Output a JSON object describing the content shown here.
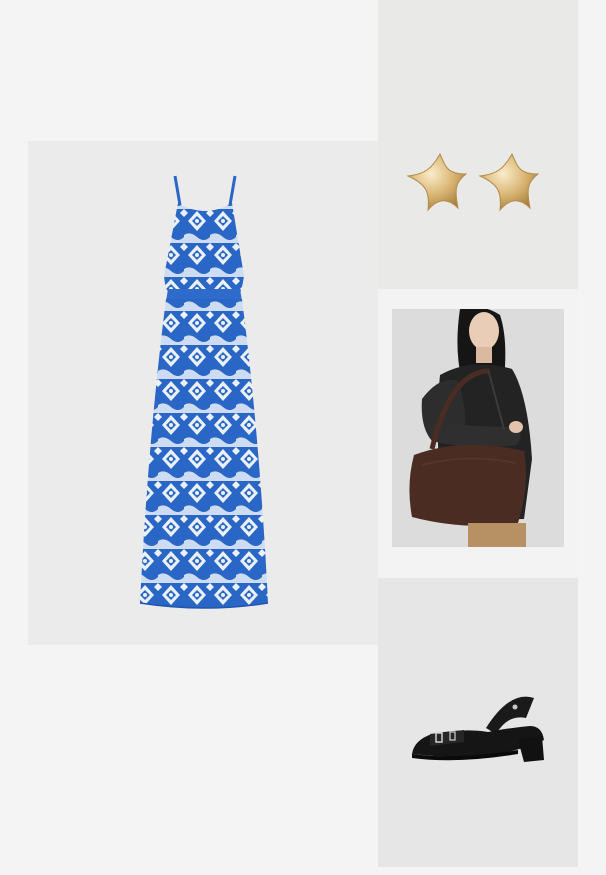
{
  "collage": {
    "background": "#f4f4f4",
    "items": [
      {
        "product": "maxi-dress",
        "color": "#2a66c6"
      },
      {
        "product": "star-earrings",
        "color": "#d8b77a"
      },
      {
        "product": "suede-shoulder-bag",
        "color": "#4a2c22"
      },
      {
        "product": "slingback-shoes",
        "color": "#1a1a1a"
      }
    ]
  }
}
